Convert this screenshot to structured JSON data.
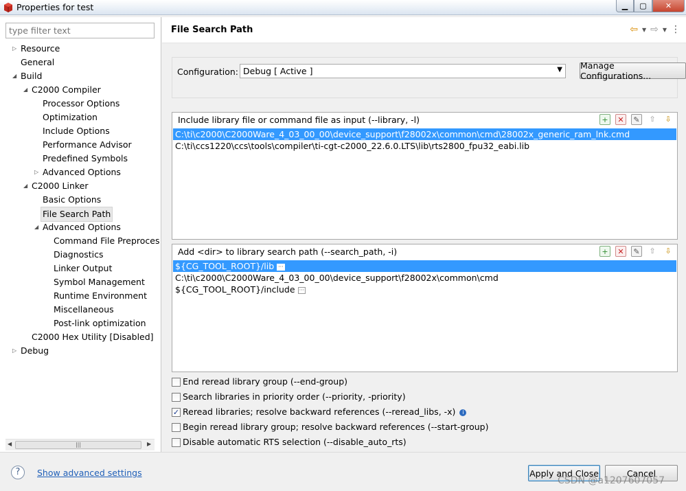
{
  "window": {
    "title": "Properties for test"
  },
  "filter": {
    "placeholder": "type filter text"
  },
  "tree": [
    {
      "label": "Resource",
      "toggle": "▷"
    },
    {
      "label": "General",
      "toggle": ""
    },
    {
      "label": "Build",
      "toggle": "◢"
    },
    {
      "label": "C2000 Compiler",
      "toggle": "◢"
    },
    {
      "label": "Processor Options",
      "toggle": ""
    },
    {
      "label": "Optimization",
      "toggle": ""
    },
    {
      "label": "Include Options",
      "toggle": ""
    },
    {
      "label": "Performance Advisor",
      "toggle": ""
    },
    {
      "label": "Predefined Symbols",
      "toggle": ""
    },
    {
      "label": "Advanced Options",
      "toggle": "▷"
    },
    {
      "label": "C2000 Linker",
      "toggle": "◢"
    },
    {
      "label": "Basic Options",
      "toggle": ""
    },
    {
      "label": "File Search Path",
      "toggle": ""
    },
    {
      "label": "Advanced Options",
      "toggle": "◢"
    },
    {
      "label": "Command File Preproces",
      "toggle": ""
    },
    {
      "label": "Diagnostics",
      "toggle": ""
    },
    {
      "label": "Linker Output",
      "toggle": ""
    },
    {
      "label": "Symbol Management",
      "toggle": ""
    },
    {
      "label": "Runtime Environment",
      "toggle": ""
    },
    {
      "label": "Miscellaneous",
      "toggle": ""
    },
    {
      "label": "Post-link optimization",
      "toggle": ""
    },
    {
      "label": "C2000 Hex Utility  [Disabled]",
      "toggle": ""
    },
    {
      "label": "Debug",
      "toggle": "▷"
    }
  ],
  "page": {
    "title": "File Search Path"
  },
  "config": {
    "label": "Configuration:",
    "value": "Debug  [ Active ]",
    "manage_label": "Manage Configurations..."
  },
  "lib_list": {
    "header": "Include library file or command file as input (--library, -l)",
    "items": [
      "C:\\ti\\c2000\\C2000Ware_4_03_00_00\\device_support\\f28002x\\common\\cmd\\28002x_generic_ram_lnk.cmd",
      "C:\\ti\\ccs1220\\ccs\\tools\\compiler\\ti-cgt-c2000_22.6.0.LTS\\lib\\rts2800_fpu32_eabi.lib"
    ]
  },
  "dir_list": {
    "header": "Add <dir> to library search path (--search_path, -i)",
    "items": [
      "${CG_TOOL_ROOT}/lib",
      "C:\\ti\\c2000\\C2000Ware_4_03_00_00\\device_support\\f28002x\\common\\cmd",
      "${CG_TOOL_ROOT}/include"
    ]
  },
  "checkboxes": [
    {
      "label": "End reread library group (--end-group)",
      "checked": false
    },
    {
      "label": "Search libraries in priority order (--priority, -priority)",
      "checked": false
    },
    {
      "label": "Reread libraries; resolve backward references (--reread_libs, -x)",
      "checked": true
    },
    {
      "label": "Begin reread library group; resolve backward references (--start-group)",
      "checked": false
    },
    {
      "label": "Disable automatic RTS selection (--disable_auto_rts)",
      "checked": false
    }
  ],
  "footer": {
    "advanced_link": "Show advanced settings",
    "apply_label": "Apply and Close",
    "cancel_label": "Cancel",
    "watermark": "CSDN @a1207607057"
  },
  "colors": {
    "selection": "#3399ff",
    "link": "#1f5fb8",
    "accent": "#d98b00"
  }
}
